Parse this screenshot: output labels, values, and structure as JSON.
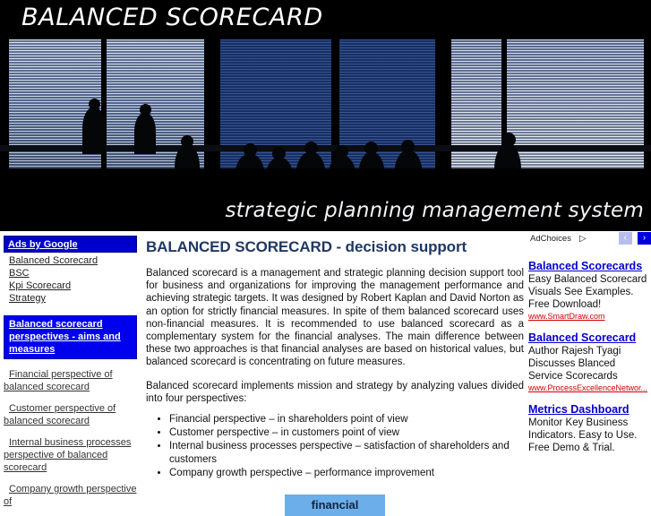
{
  "banner": {
    "title": "BALANCED SCORECARD",
    "tagline": "strategic planning management system",
    "photo_alt": "office-meeting-world-map-photo"
  },
  "sidebar": {
    "ads_header": "Ads by Google",
    "ad_links": [
      {
        "label": "Balanced Scorecard"
      },
      {
        "label": "BSC"
      },
      {
        "label": "Kpi Scorecard"
      },
      {
        "label": "Strategy"
      }
    ],
    "highlight": "Balanced scorecard perspectives - aims and measures",
    "items": [
      {
        "label": "Financial perspective of balanced scorecard"
      },
      {
        "label": "Customer perspective of balanced scorecard"
      },
      {
        "label": "Internal business processes perspective of balanced scorecard"
      },
      {
        "label": "Company growth perspective of"
      }
    ]
  },
  "main": {
    "title": "BALANCED SCORECARD - decision support",
    "paragraph1": "Balanced scorecard is a management and strategic planning decision support tool for business and organizations for improving the management performance and achieving strategic targets. It was designed by Robert Kaplan and David Norton as an option for strictly financial measures. In spite of them balanced scorecard uses non-financial measures. It is recommended to use balanced scorecard as a complementary system for the financial analyses. The main difference between these two approaches is that financial analyses are based on historical values, but balanced scorecard is concentrating on future measures.",
    "paragraph2": "Balanced scorecard implements mission and strategy by analyzing values divided into four perspectives:",
    "perspectives": [
      "Financial perspective – in shareholders point of view",
      "Customer perspective – in customers point of view",
      "Internal business processes perspective – satisfaction of shareholders and customers",
      "Company growth perspective – performance improvement"
    ],
    "diagram_chip": "financial"
  },
  "ads": {
    "adchoices_label": "AdChoices",
    "adchoices_icon": "triangle-play-icon",
    "prev_arrow": "‹",
    "next_arrow": "›",
    "items": [
      {
        "title": "Balanced Scorecards",
        "lines": [
          "Easy Balanced Scorecard",
          "Visuals See Examples.",
          "Free Download!"
        ],
        "url": "www.SmartDraw.com"
      },
      {
        "title": "Balanced Scorecard",
        "lines": [
          "Author Rajesh Tyagi",
          "Discusses Blanced",
          "Service Scorecards"
        ],
        "url": "www.ProcessExcellenceNetwor..."
      },
      {
        "title": "Metrics Dashboard",
        "lines": [
          "Monitor Key Business",
          "Indicators. Easy to Use.",
          "Free Demo & Trial."
        ],
        "url": ""
      }
    ]
  },
  "colors": {
    "ads_header_bg": "#0000CC",
    "nav_highlight_bg": "#0000EE",
    "heading": "#1F3864",
    "link_blue": "#0000CC",
    "url_red": "#CC0000",
    "chip_blue": "#6CAEEA"
  }
}
